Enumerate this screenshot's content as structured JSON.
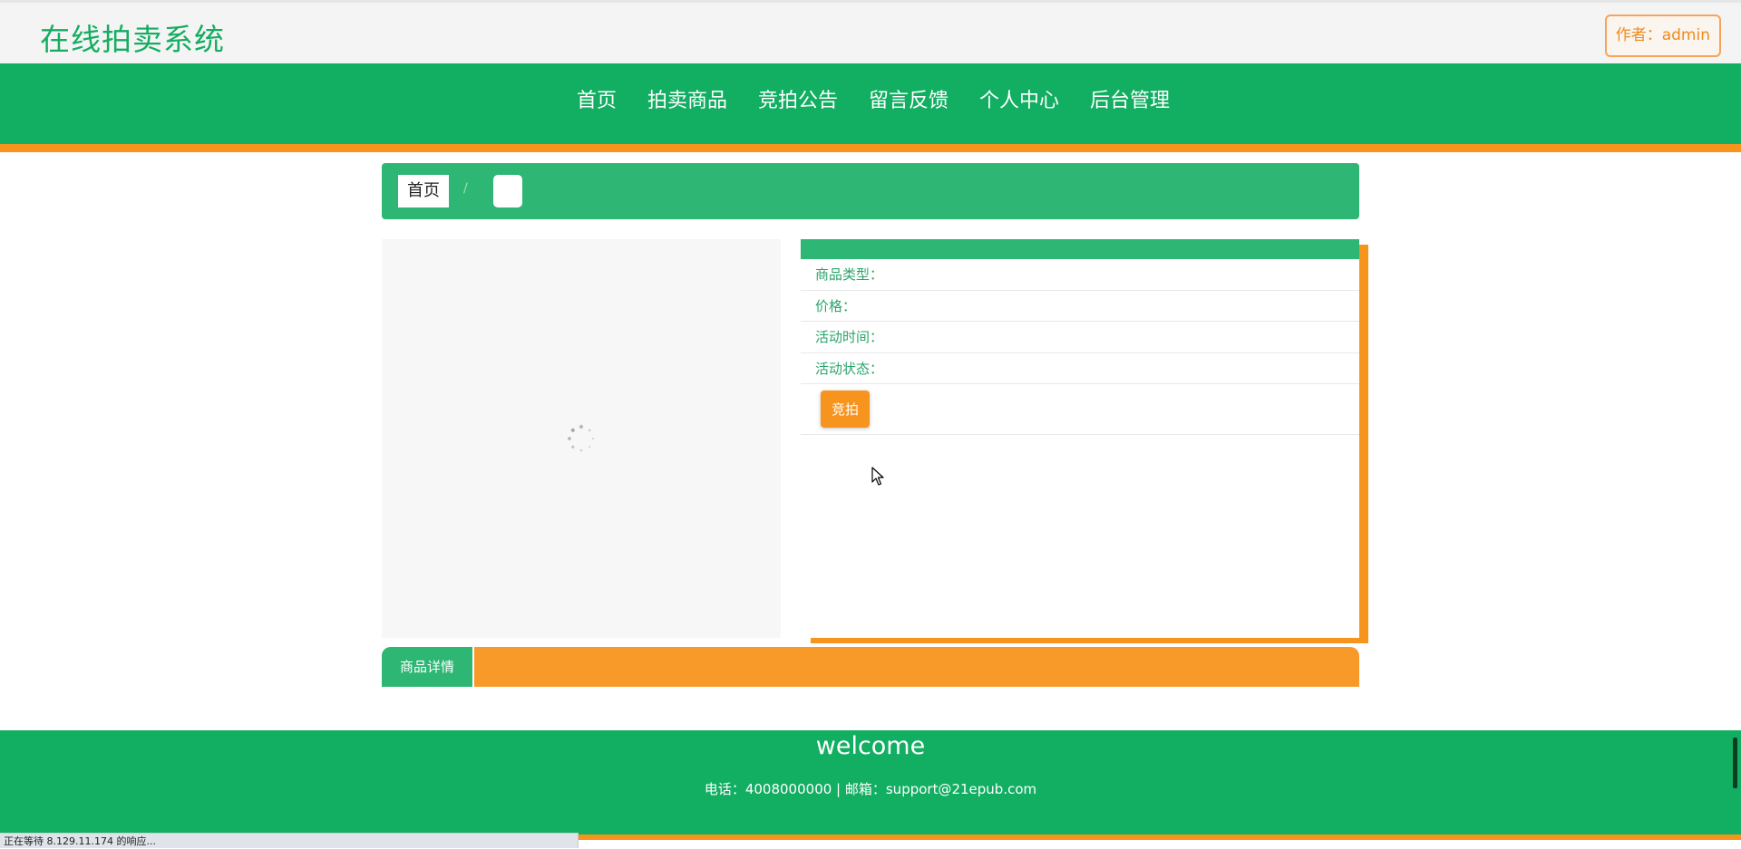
{
  "header": {
    "site_title": "在线拍卖系统",
    "author_label": "作者：admin"
  },
  "nav": {
    "items": [
      {
        "label": "首页"
      },
      {
        "label": "拍卖商品"
      },
      {
        "label": "竞拍公告"
      },
      {
        "label": "留言反馈"
      },
      {
        "label": "个人中心"
      },
      {
        "label": "后台管理"
      }
    ]
  },
  "breadcrumb": {
    "home": "首页",
    "separator": "/",
    "current": ""
  },
  "product": {
    "fields": [
      {
        "label": "商品类型：",
        "value": ""
      },
      {
        "label": "价格：",
        "value": ""
      },
      {
        "label": "活动时间：",
        "value": ""
      },
      {
        "label": "活动状态：",
        "value": ""
      }
    ],
    "bid_button": "竞拍",
    "image_state": "loading-spinner-icon"
  },
  "detail_tab": {
    "label": "商品详情"
  },
  "footer": {
    "welcome": "welcome",
    "contact": "电话：4008000000 | 邮箱：support@21epub.com"
  },
  "browser_status": {
    "text": "正在等待 8.129.11.174 的响应..."
  },
  "colors": {
    "green": "#12ae62",
    "green_light": "#2db674",
    "orange": "#f7941d"
  }
}
